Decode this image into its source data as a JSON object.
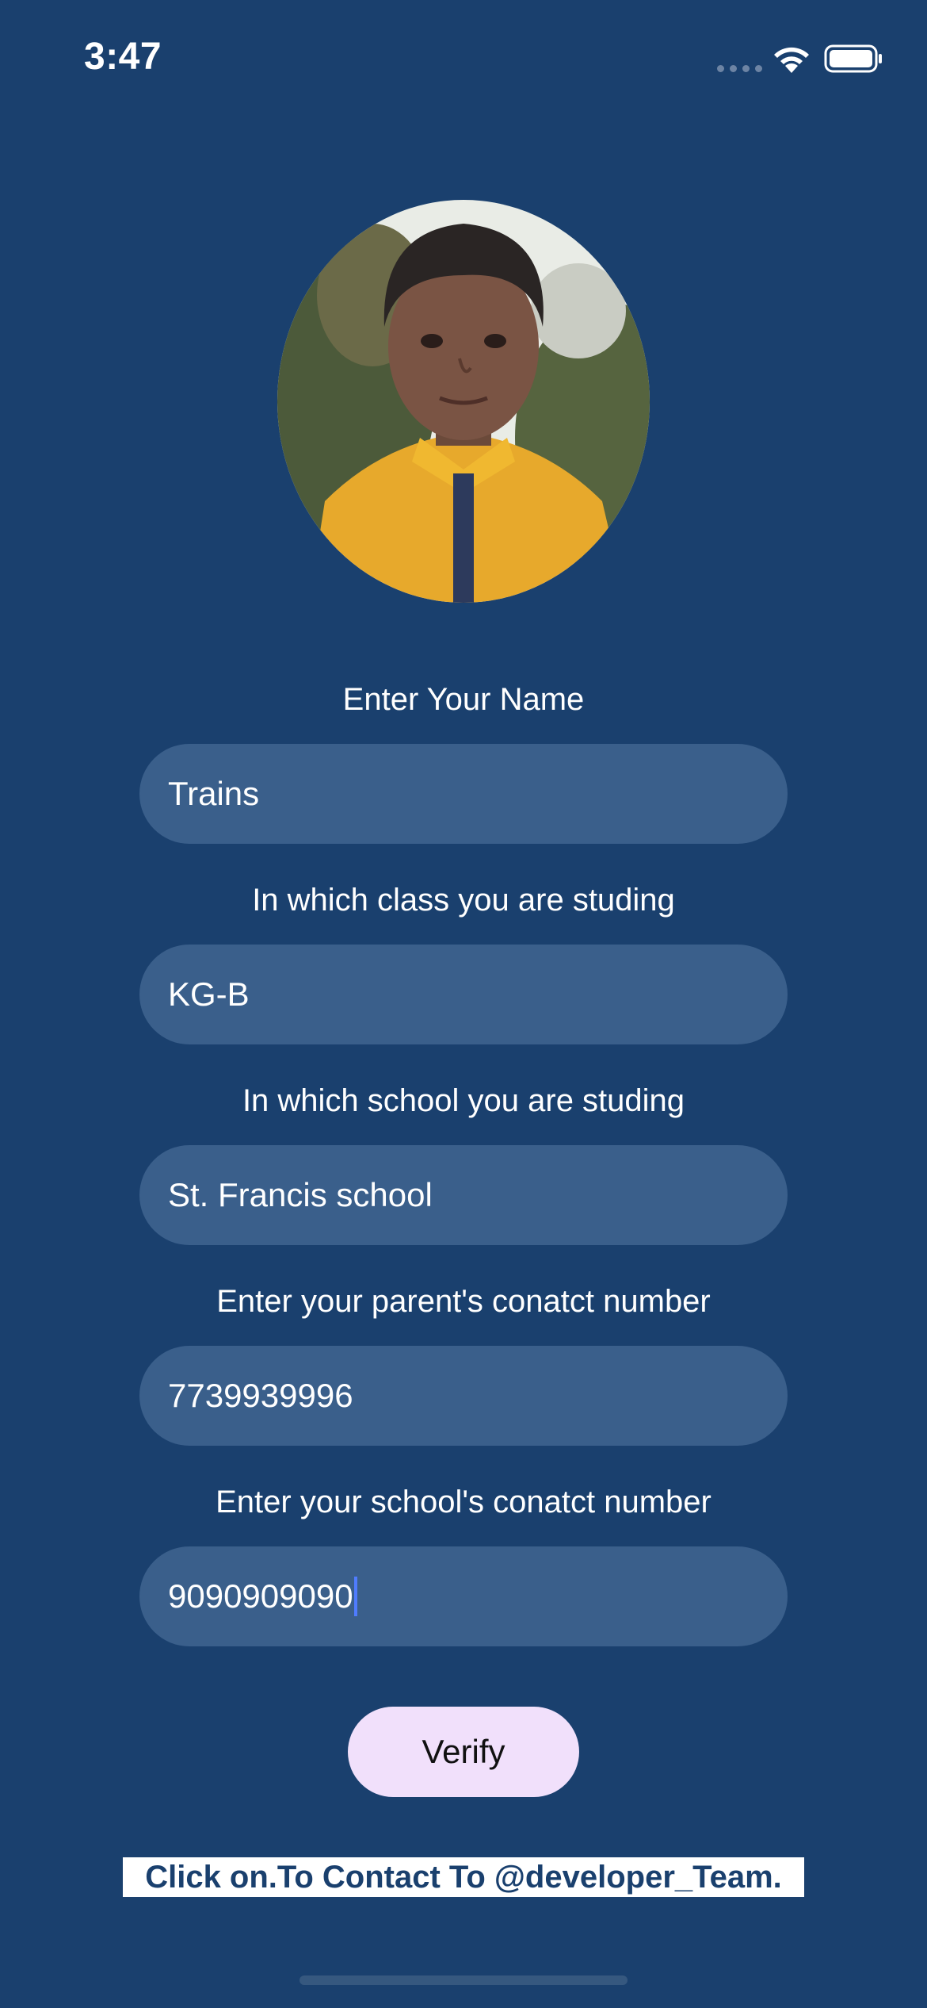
{
  "status_bar": {
    "time": "3:47"
  },
  "profile": {
    "avatar_icon": "profile-photo"
  },
  "form": {
    "name": {
      "label": "Enter Your Name",
      "value": "Trains"
    },
    "class": {
      "label": "In which class you are studing",
      "value": "KG-B"
    },
    "school": {
      "label": "In which school you are studing",
      "value": "St. Francis school"
    },
    "parent_contact": {
      "label": "Enter your parent's conatct number",
      "value": "7739939996"
    },
    "school_contact": {
      "label": "Enter your school's conatct number",
      "value": "9090909090"
    }
  },
  "actions": {
    "verify_label": "Verify"
  },
  "footer": {
    "contact_text": "Click on.To Contact To @developer_Team."
  },
  "colors": {
    "background": "#1a406e",
    "field": "#3a5f8b",
    "button": "#f1e0fb"
  }
}
